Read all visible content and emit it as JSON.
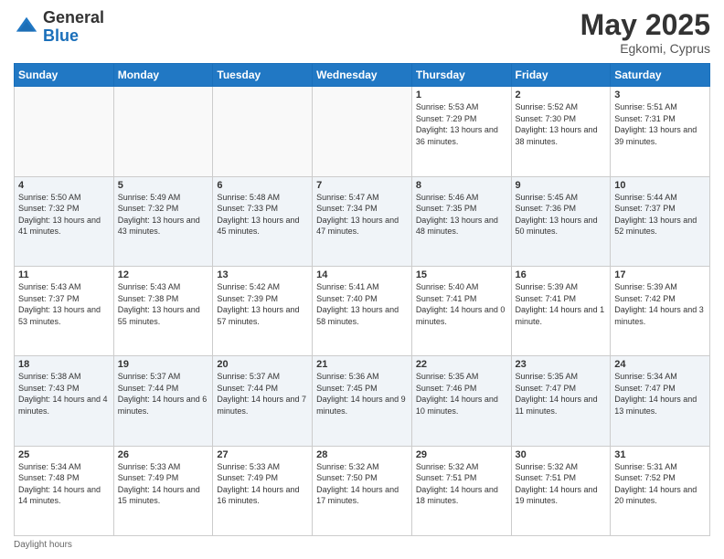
{
  "logo": {
    "general": "General",
    "blue": "Blue"
  },
  "header": {
    "month_year": "May 2025",
    "location": "Egkomi, Cyprus"
  },
  "days_of_week": [
    "Sunday",
    "Monday",
    "Tuesday",
    "Wednesday",
    "Thursday",
    "Friday",
    "Saturday"
  ],
  "weeks": [
    {
      "days": [
        {
          "num": "",
          "empty": true
        },
        {
          "num": "",
          "empty": true
        },
        {
          "num": "",
          "empty": true
        },
        {
          "num": "",
          "empty": true
        },
        {
          "num": "1",
          "sunrise": "5:53 AM",
          "sunset": "7:29 PM",
          "daylight": "13 hours and 36 minutes."
        },
        {
          "num": "2",
          "sunrise": "5:52 AM",
          "sunset": "7:30 PM",
          "daylight": "13 hours and 38 minutes."
        },
        {
          "num": "3",
          "sunrise": "5:51 AM",
          "sunset": "7:31 PM",
          "daylight": "13 hours and 39 minutes."
        }
      ]
    },
    {
      "days": [
        {
          "num": "4",
          "sunrise": "5:50 AM",
          "sunset": "7:32 PM",
          "daylight": "13 hours and 41 minutes."
        },
        {
          "num": "5",
          "sunrise": "5:49 AM",
          "sunset": "7:32 PM",
          "daylight": "13 hours and 43 minutes."
        },
        {
          "num": "6",
          "sunrise": "5:48 AM",
          "sunset": "7:33 PM",
          "daylight": "13 hours and 45 minutes."
        },
        {
          "num": "7",
          "sunrise": "5:47 AM",
          "sunset": "7:34 PM",
          "daylight": "13 hours and 47 minutes."
        },
        {
          "num": "8",
          "sunrise": "5:46 AM",
          "sunset": "7:35 PM",
          "daylight": "13 hours and 48 minutes."
        },
        {
          "num": "9",
          "sunrise": "5:45 AM",
          "sunset": "7:36 PM",
          "daylight": "13 hours and 50 minutes."
        },
        {
          "num": "10",
          "sunrise": "5:44 AM",
          "sunset": "7:37 PM",
          "daylight": "13 hours and 52 minutes."
        }
      ]
    },
    {
      "days": [
        {
          "num": "11",
          "sunrise": "5:43 AM",
          "sunset": "7:37 PM",
          "daylight": "13 hours and 53 minutes."
        },
        {
          "num": "12",
          "sunrise": "5:43 AM",
          "sunset": "7:38 PM",
          "daylight": "13 hours and 55 minutes."
        },
        {
          "num": "13",
          "sunrise": "5:42 AM",
          "sunset": "7:39 PM",
          "daylight": "13 hours and 57 minutes."
        },
        {
          "num": "14",
          "sunrise": "5:41 AM",
          "sunset": "7:40 PM",
          "daylight": "13 hours and 58 minutes."
        },
        {
          "num": "15",
          "sunrise": "5:40 AM",
          "sunset": "7:41 PM",
          "daylight": "14 hours and 0 minutes."
        },
        {
          "num": "16",
          "sunrise": "5:39 AM",
          "sunset": "7:41 PM",
          "daylight": "14 hours and 1 minute."
        },
        {
          "num": "17",
          "sunrise": "5:39 AM",
          "sunset": "7:42 PM",
          "daylight": "14 hours and 3 minutes."
        }
      ]
    },
    {
      "days": [
        {
          "num": "18",
          "sunrise": "5:38 AM",
          "sunset": "7:43 PM",
          "daylight": "14 hours and 4 minutes."
        },
        {
          "num": "19",
          "sunrise": "5:37 AM",
          "sunset": "7:44 PM",
          "daylight": "14 hours and 6 minutes."
        },
        {
          "num": "20",
          "sunrise": "5:37 AM",
          "sunset": "7:44 PM",
          "daylight": "14 hours and 7 minutes."
        },
        {
          "num": "21",
          "sunrise": "5:36 AM",
          "sunset": "7:45 PM",
          "daylight": "14 hours and 9 minutes."
        },
        {
          "num": "22",
          "sunrise": "5:35 AM",
          "sunset": "7:46 PM",
          "daylight": "14 hours and 10 minutes."
        },
        {
          "num": "23",
          "sunrise": "5:35 AM",
          "sunset": "7:47 PM",
          "daylight": "14 hours and 11 minutes."
        },
        {
          "num": "24",
          "sunrise": "5:34 AM",
          "sunset": "7:47 PM",
          "daylight": "14 hours and 13 minutes."
        }
      ]
    },
    {
      "days": [
        {
          "num": "25",
          "sunrise": "5:34 AM",
          "sunset": "7:48 PM",
          "daylight": "14 hours and 14 minutes."
        },
        {
          "num": "26",
          "sunrise": "5:33 AM",
          "sunset": "7:49 PM",
          "daylight": "14 hours and 15 minutes."
        },
        {
          "num": "27",
          "sunrise": "5:33 AM",
          "sunset": "7:49 PM",
          "daylight": "14 hours and 16 minutes."
        },
        {
          "num": "28",
          "sunrise": "5:32 AM",
          "sunset": "7:50 PM",
          "daylight": "14 hours and 17 minutes."
        },
        {
          "num": "29",
          "sunrise": "5:32 AM",
          "sunset": "7:51 PM",
          "daylight": "14 hours and 18 minutes."
        },
        {
          "num": "30",
          "sunrise": "5:32 AM",
          "sunset": "7:51 PM",
          "daylight": "14 hours and 19 minutes."
        },
        {
          "num": "31",
          "sunrise": "5:31 AM",
          "sunset": "7:52 PM",
          "daylight": "14 hours and 20 minutes."
        }
      ]
    }
  ],
  "footer": {
    "daylight_label": "Daylight hours"
  },
  "labels": {
    "sunrise_prefix": "Sunrise: ",
    "sunset_prefix": "Sunset: ",
    "daylight_prefix": "Daylight: "
  }
}
